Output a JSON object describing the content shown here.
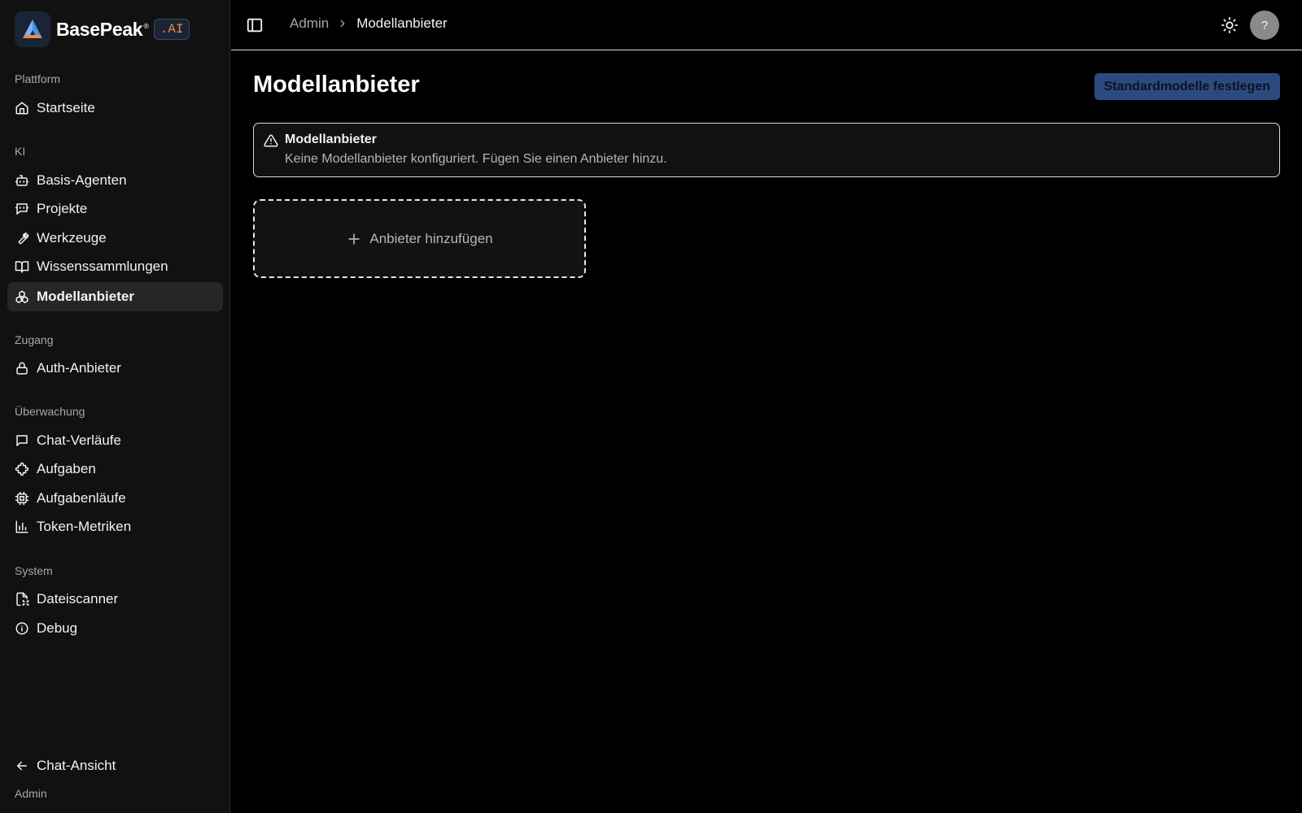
{
  "brand": {
    "name": "BasePeak",
    "registered": "®",
    "suffix": ".AI"
  },
  "sidebar": {
    "sections": [
      {
        "label": "Plattform",
        "items": [
          {
            "label": "Startseite",
            "icon": "home-icon"
          }
        ]
      },
      {
        "label": "KI",
        "items": [
          {
            "label": "Basis-Agenten",
            "icon": "bot-icon"
          },
          {
            "label": "Projekte",
            "icon": "message-bot-icon"
          },
          {
            "label": "Werkzeuge",
            "icon": "wrench-icon"
          },
          {
            "label": "Wissenssammlungen",
            "icon": "book-open-icon"
          },
          {
            "label": "Modellanbieter",
            "icon": "boxes-icon",
            "active": true
          }
        ]
      },
      {
        "label": "Zugang",
        "items": [
          {
            "label": "Auth-Anbieter",
            "icon": "lock-icon"
          }
        ]
      },
      {
        "label": "Überwachung",
        "items": [
          {
            "label": "Chat-Verläufe",
            "icon": "message-square-icon"
          },
          {
            "label": "Aufgaben",
            "icon": "puzzle-icon"
          },
          {
            "label": "Aufgabenläufe",
            "icon": "cpu-icon"
          },
          {
            "label": "Token-Metriken",
            "icon": "bar-chart-icon"
          }
        ]
      },
      {
        "label": "System",
        "items": [
          {
            "label": "Dateiscanner",
            "icon": "file-scan-icon"
          },
          {
            "label": "Debug",
            "icon": "info-icon"
          }
        ]
      }
    ],
    "footer": {
      "back_label": "Chat-Ansicht",
      "role_label": "Admin"
    }
  },
  "topbar": {
    "breadcrumb": [
      {
        "label": "Admin"
      },
      {
        "label": "Modellanbieter"
      }
    ],
    "help_label": "?"
  },
  "main": {
    "title": "Modellanbieter",
    "primary_button": "Standardmodelle festlegen",
    "alert": {
      "title": "Modellanbieter",
      "description": "Keine Modellanbieter konfiguriert. Fügen Sie einen Anbieter hinzu."
    },
    "add_card_label": "Anbieter hinzufügen"
  },
  "colors": {
    "accent_button": "#2d4a80",
    "brand_orange": "#f08a3c",
    "sidebar_bg": "#111111",
    "page_bg": "#000000"
  }
}
